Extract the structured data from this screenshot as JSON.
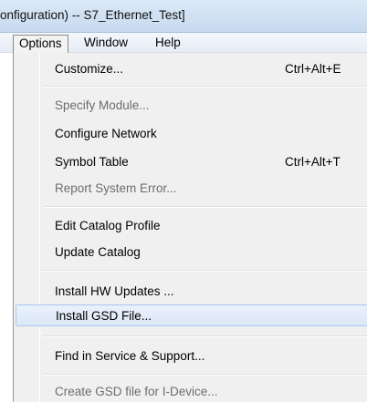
{
  "window": {
    "title": "onfiguration) -- S7_Ethernet_Test]"
  },
  "menubar": {
    "items": [
      {
        "label": "Options"
      },
      {
        "label": "Window"
      },
      {
        "label": "Help"
      }
    ]
  },
  "dropdown": {
    "items": [
      {
        "label": "Customize...",
        "shortcut": "Ctrl+Alt+E",
        "enabled": true
      },
      {
        "label": "Specify Module...",
        "shortcut": "",
        "enabled": false
      },
      {
        "label": "Configure Network",
        "shortcut": "",
        "enabled": true
      },
      {
        "label": "Symbol Table",
        "shortcut": "Ctrl+Alt+T",
        "enabled": true
      },
      {
        "label": "Report System Error...",
        "shortcut": "",
        "enabled": false
      },
      {
        "label": "Edit Catalog Profile",
        "shortcut": "",
        "enabled": true
      },
      {
        "label": "Update Catalog",
        "shortcut": "",
        "enabled": true
      },
      {
        "label": "Install HW Updates ...",
        "shortcut": "",
        "enabled": true
      },
      {
        "label": "Install GSD File...",
        "shortcut": "",
        "enabled": true,
        "highlighted": true
      },
      {
        "label": "Find in Service & Support...",
        "shortcut": "",
        "enabled": true
      },
      {
        "label": "Create GSD file for I-Device...",
        "shortcut": "",
        "enabled": false
      }
    ]
  }
}
